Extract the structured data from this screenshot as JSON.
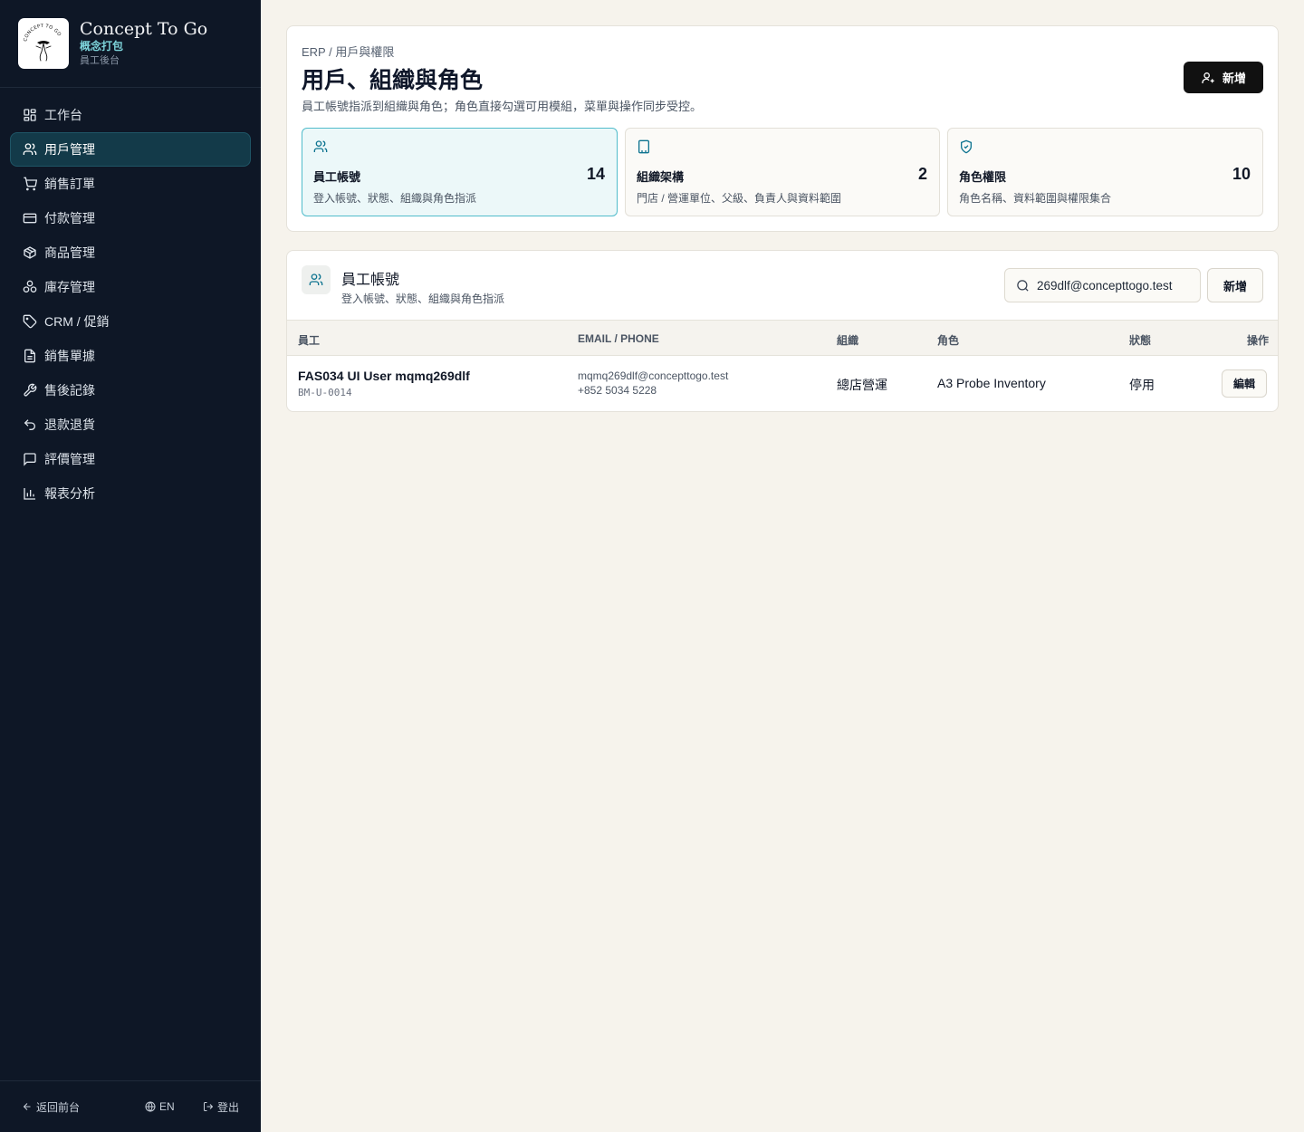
{
  "brand": {
    "logo_text": "CONCEPT TO GO",
    "name": "Concept To Go",
    "name_cn": "概念打包",
    "subtitle": "員工後台"
  },
  "sidebar": {
    "items": [
      {
        "label": "工作台",
        "icon": "dashboard-icon",
        "active": false
      },
      {
        "label": "用戶管理",
        "icon": "users-icon",
        "active": true
      },
      {
        "label": "銷售訂單",
        "icon": "cart-icon",
        "active": false
      },
      {
        "label": "付款管理",
        "icon": "credit-card-icon",
        "active": false
      },
      {
        "label": "商品管理",
        "icon": "package-icon",
        "active": false
      },
      {
        "label": "庫存管理",
        "icon": "boxes-icon",
        "active": false
      },
      {
        "label": "CRM / 促銷",
        "icon": "tag-icon",
        "active": false
      },
      {
        "label": "銷售單據",
        "icon": "document-icon",
        "active": false
      },
      {
        "label": "售後記錄",
        "icon": "wrench-icon",
        "active": false
      },
      {
        "label": "退款退貨",
        "icon": "undo-icon",
        "active": false
      },
      {
        "label": "評價管理",
        "icon": "message-icon",
        "active": false
      },
      {
        "label": "報表分析",
        "icon": "bar-chart-icon",
        "active": false
      }
    ],
    "footer": {
      "back_label": "返回前台",
      "lang_label": "EN",
      "logout_label": "登出"
    }
  },
  "header": {
    "breadcrumb": "ERP / 用戶與權限",
    "title": "用戶、組織與角色",
    "description": "員工帳號指派到組織與角色；角色直接勾選可用模組，菜單與操作同步受控。",
    "add_label": "新增"
  },
  "stats": [
    {
      "title": "員工帳號",
      "count": "14",
      "desc": "登入帳號、狀態、組織與角色指派",
      "icon": "users-icon",
      "active": true
    },
    {
      "title": "組織架構",
      "count": "2",
      "desc": "門店 / 營運單位、父級、負責人與資料範圍",
      "icon": "building-icon",
      "active": false
    },
    {
      "title": "角色權限",
      "count": "10",
      "desc": "角色名稱、資料範圍與權限集合",
      "icon": "shield-check-icon",
      "active": false
    }
  ],
  "list": {
    "title": "員工帳號",
    "subtitle": "登入帳號、狀態、組織與角色指派",
    "search_value": "269dlf@concepttogo.test",
    "add_label": "新增",
    "columns": [
      "員工",
      "EMAIL / PHONE",
      "組織",
      "角色",
      "狀態",
      "操作"
    ],
    "rows": [
      {
        "name": "FAS034 UI User mqmq269dlf",
        "code": "BM-U-0014",
        "email": "mqmq269dlf@concepttogo.test",
        "phone": "+852 5034 5228",
        "org": "總店營運",
        "role": "A3 Probe Inventory",
        "status": "停用",
        "action": "編輯"
      }
    ]
  },
  "colors": {
    "sidebar_bg": "#0e1726",
    "active_nav_bg": "#133a49",
    "accent": "#0e7490",
    "page_bg": "#f6f3ec",
    "primary_button": "#111111"
  }
}
